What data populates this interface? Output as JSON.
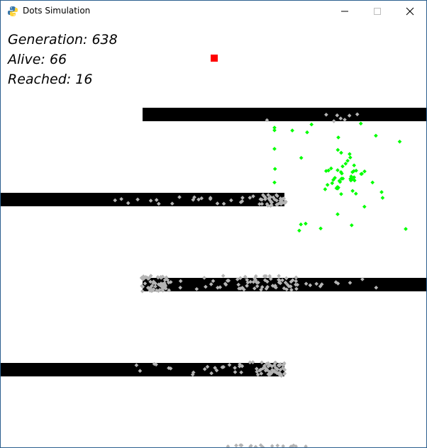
{
  "window": {
    "title": "Dots Simulation",
    "icon": "python-icon"
  },
  "hud": {
    "generation_label": "Generation:",
    "generation": 638,
    "alive_label": "Alive:",
    "alive": 66,
    "reached_label": "Reached:",
    "reached": 16
  },
  "colors": {
    "obstacle": "#000000",
    "dead_dot": "#b4b4b4",
    "alive_dot": "#00ff00",
    "target": "#ff0000",
    "background": "#ffffff"
  },
  "obstacles": {
    "count": 4
  },
  "dots": {
    "alive_shown": 66,
    "dead_shown": 300
  }
}
